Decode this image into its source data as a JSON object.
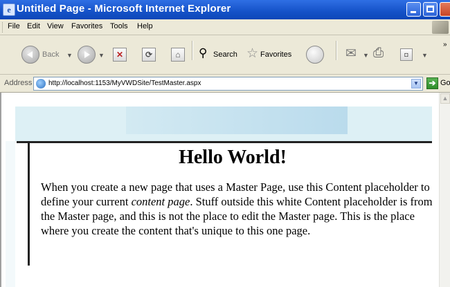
{
  "window": {
    "title": "Untitled Page - Microsoft Internet Explorer",
    "app_icon": "ie-icon"
  },
  "menu": {
    "items": [
      "File",
      "Edit",
      "View",
      "Favorites",
      "Tools",
      "Help"
    ]
  },
  "toolbar": {
    "back_label": "Back",
    "search_label": "Search",
    "favorites_label": "Favorites",
    "overflow": "»"
  },
  "address_bar": {
    "label": "Address",
    "url": "http://localhost:1153/MyVWDSite/TestMaster.aspx",
    "go_label": "Go"
  },
  "content": {
    "heading": "Hello World!",
    "text_before_italic": "When you create a new page that uses a Master Page, use this Content placeholder to define your current ",
    "italic_text": "content page",
    "text_after_italic": ". Stuff outside this white Content placeholder is from the Master page, and this is not the place to edit the Master page. This is the place where you create the content that's unique to this one page."
  },
  "colors": {
    "titlebar": "#1552c8",
    "chrome": "#ece9d8",
    "master_area": "#ddf0f5"
  }
}
